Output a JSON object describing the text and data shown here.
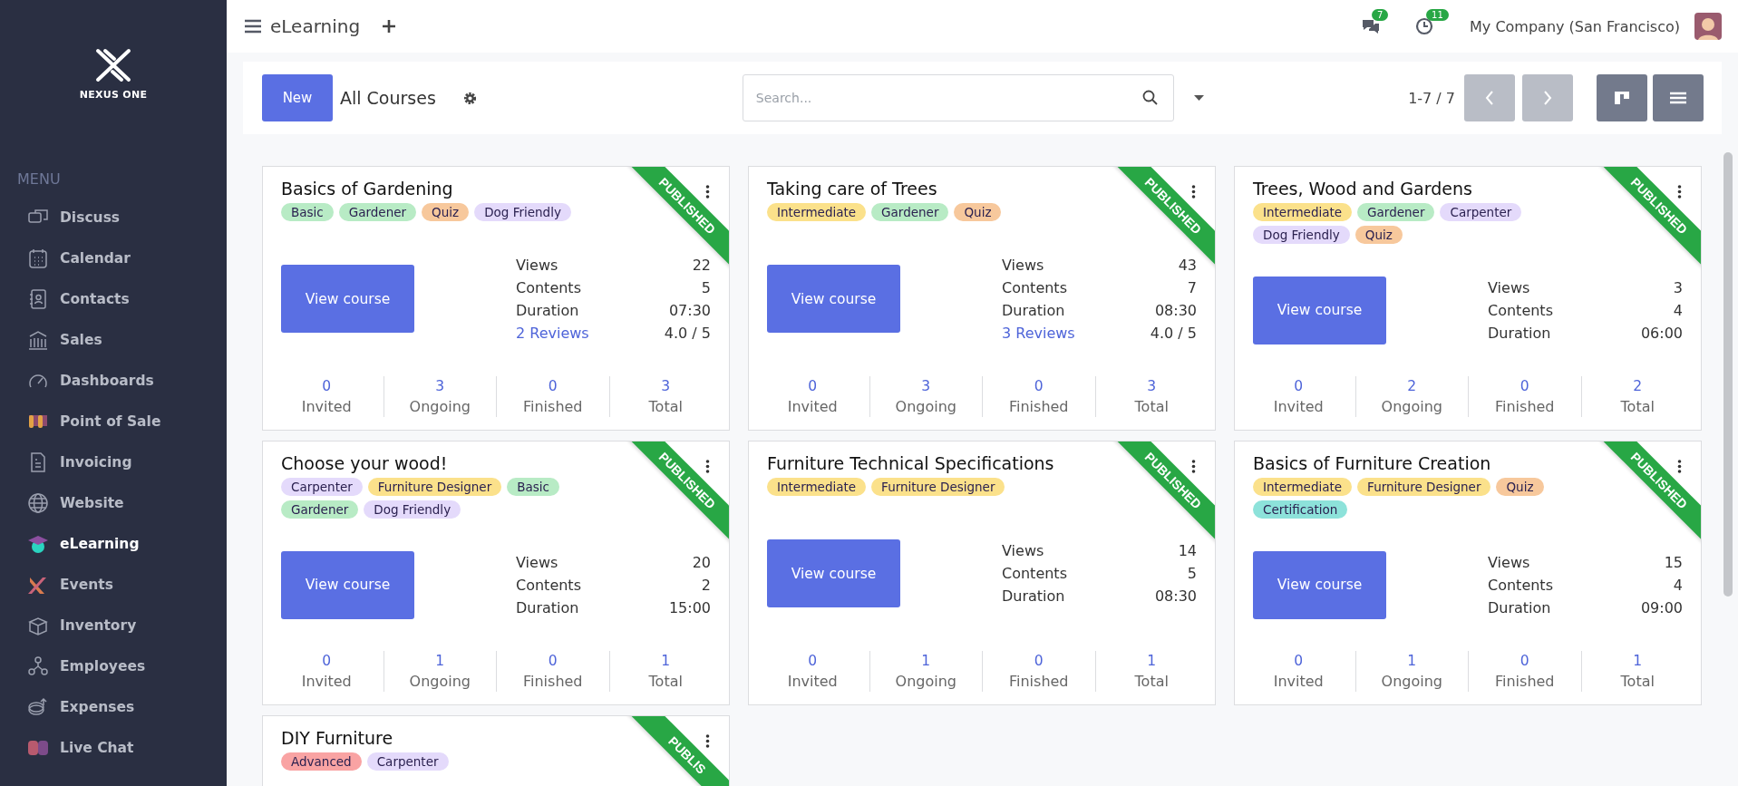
{
  "brand": {
    "name": "NEXUS ONE"
  },
  "sidebar": {
    "heading": "MENU",
    "items": [
      {
        "label": "Discuss",
        "selected": false
      },
      {
        "label": "Calendar",
        "selected": false
      },
      {
        "label": "Contacts",
        "selected": false
      },
      {
        "label": "Sales",
        "selected": false
      },
      {
        "label": "Dashboards",
        "selected": false
      },
      {
        "label": "Point of Sale",
        "selected": false
      },
      {
        "label": "Invoicing",
        "selected": false
      },
      {
        "label": "Website",
        "selected": false
      },
      {
        "label": "eLearning",
        "selected": true
      },
      {
        "label": "Events",
        "selected": false
      },
      {
        "label": "Inventory",
        "selected": false
      },
      {
        "label": "Employees",
        "selected": false
      },
      {
        "label": "Expenses",
        "selected": false
      },
      {
        "label": "Live Chat",
        "selected": false
      }
    ]
  },
  "topbar": {
    "app_title": "eLearning",
    "messages_badge": "7",
    "activities_badge": "11",
    "company": "My Company (San Francisco)"
  },
  "control_panel": {
    "new_button": "New",
    "breadcrumb": "All Courses",
    "search": {
      "placeholder": "Search..."
    },
    "pager": "1-7 / 7",
    "prev_disabled": true,
    "next_disabled": true
  },
  "courses": [
    {
      "title": "Basics of Gardening",
      "ribbon": "PUBLISHED",
      "tags": [
        {
          "label": "Basic",
          "color": "#b8ebc5"
        },
        {
          "label": "Gardener",
          "color": "#b8ebc5"
        },
        {
          "label": "Quiz",
          "color": "#f7c89c"
        },
        {
          "label": "Dog Friendly",
          "color": "#e4dafb"
        }
      ],
      "button": "View course",
      "stats": [
        {
          "kind": "plain",
          "label": "Views",
          "value": "22"
        },
        {
          "kind": "plain",
          "label": "Contents",
          "value": "5"
        },
        {
          "kind": "plain",
          "label": "Duration",
          "value": "07:30"
        },
        {
          "kind": "link",
          "label": "2 Reviews",
          "value": "4.0 / 5"
        }
      ],
      "counters": [
        {
          "value": "0",
          "label": "Invited"
        },
        {
          "value": "3",
          "label": "Ongoing"
        },
        {
          "value": "0",
          "label": "Finished"
        },
        {
          "value": "3",
          "label": "Total"
        }
      ]
    },
    {
      "title": "Taking care of Trees",
      "ribbon": "PUBLISHED",
      "tags": [
        {
          "label": "Intermediate",
          "color": "#fbe18b"
        },
        {
          "label": "Gardener",
          "color": "#b8ebc5"
        },
        {
          "label": "Quiz",
          "color": "#f7c89c"
        }
      ],
      "button": "View course",
      "stats": [
        {
          "kind": "plain",
          "label": "Views",
          "value": "43"
        },
        {
          "kind": "plain",
          "label": "Contents",
          "value": "7"
        },
        {
          "kind": "plain",
          "label": "Duration",
          "value": "08:30"
        },
        {
          "kind": "link",
          "label": "3 Reviews",
          "value": "4.0 / 5"
        }
      ],
      "counters": [
        {
          "value": "0",
          "label": "Invited"
        },
        {
          "value": "3",
          "label": "Ongoing"
        },
        {
          "value": "0",
          "label": "Finished"
        },
        {
          "value": "3",
          "label": "Total"
        }
      ]
    },
    {
      "title": "Trees, Wood and Gardens",
      "ribbon": "PUBLISHED",
      "tags": [
        {
          "label": "Intermediate",
          "color": "#fbe18b"
        },
        {
          "label": "Gardener",
          "color": "#b8ebc5"
        },
        {
          "label": "Carpenter",
          "color": "#e4dafb"
        },
        {
          "label": "Dog Friendly",
          "color": "#e4dafb"
        },
        {
          "label": "Quiz",
          "color": "#f7c89c"
        }
      ],
      "button": "View course",
      "stats": [
        {
          "kind": "plain",
          "label": "Views",
          "value": "3"
        },
        {
          "kind": "plain",
          "label": "Contents",
          "value": "4"
        },
        {
          "kind": "plain",
          "label": "Duration",
          "value": "06:00"
        }
      ],
      "counters": [
        {
          "value": "0",
          "label": "Invited"
        },
        {
          "value": "2",
          "label": "Ongoing"
        },
        {
          "value": "0",
          "label": "Finished"
        },
        {
          "value": "2",
          "label": "Total"
        }
      ]
    },
    {
      "title": "Choose your wood!",
      "ribbon": "PUBLISHED",
      "tags": [
        {
          "label": "Carpenter",
          "color": "#e4dafb"
        },
        {
          "label": "Furniture Designer",
          "color": "#fbe18b"
        },
        {
          "label": "Basic",
          "color": "#b8ebc5"
        },
        {
          "label": "Gardener",
          "color": "#b8ebc5"
        },
        {
          "label": "Dog Friendly",
          "color": "#e4dafb"
        }
      ],
      "button": "View course",
      "stats": [
        {
          "kind": "plain",
          "label": "Views",
          "value": "20"
        },
        {
          "kind": "plain",
          "label": "Contents",
          "value": "2"
        },
        {
          "kind": "plain",
          "label": "Duration",
          "value": "15:00"
        }
      ],
      "counters": [
        {
          "value": "0",
          "label": "Invited"
        },
        {
          "value": "1",
          "label": "Ongoing"
        },
        {
          "value": "0",
          "label": "Finished"
        },
        {
          "value": "1",
          "label": "Total"
        }
      ]
    },
    {
      "title": "Furniture Technical Specifications",
      "ribbon": "PUBLISHED",
      "tags": [
        {
          "label": "Intermediate",
          "color": "#fbe18b"
        },
        {
          "label": "Furniture Designer",
          "color": "#fbe18b"
        }
      ],
      "button": "View course",
      "stats": [
        {
          "kind": "plain",
          "label": "Views",
          "value": "14"
        },
        {
          "kind": "plain",
          "label": "Contents",
          "value": "5"
        },
        {
          "kind": "plain",
          "label": "Duration",
          "value": "08:30"
        }
      ],
      "counters": [
        {
          "value": "0",
          "label": "Invited"
        },
        {
          "value": "1",
          "label": "Ongoing"
        },
        {
          "value": "0",
          "label": "Finished"
        },
        {
          "value": "1",
          "label": "Total"
        }
      ]
    },
    {
      "title": "Basics of Furniture Creation",
      "ribbon": "PUBLISHED",
      "tags": [
        {
          "label": "Intermediate",
          "color": "#fbe18b"
        },
        {
          "label": "Furniture Designer",
          "color": "#fbe18b"
        },
        {
          "label": "Quiz",
          "color": "#f7c89c"
        },
        {
          "label": "Certification",
          "color": "#8de2da"
        }
      ],
      "button": "View course",
      "stats": [
        {
          "kind": "plain",
          "label": "Views",
          "value": "15"
        },
        {
          "kind": "plain",
          "label": "Contents",
          "value": "4"
        },
        {
          "kind": "plain",
          "label": "Duration",
          "value": "09:00"
        }
      ],
      "counters": [
        {
          "value": "0",
          "label": "Invited"
        },
        {
          "value": "1",
          "label": "Ongoing"
        },
        {
          "value": "0",
          "label": "Finished"
        },
        {
          "value": "1",
          "label": "Total"
        }
      ]
    },
    {
      "title": "DIY Furniture",
      "ribbon": "PUBLIS",
      "tags": [
        {
          "label": "Advanced",
          "color": "#f9a3a3"
        },
        {
          "label": "Carpenter",
          "color": "#e4dafb"
        }
      ]
    }
  ]
}
